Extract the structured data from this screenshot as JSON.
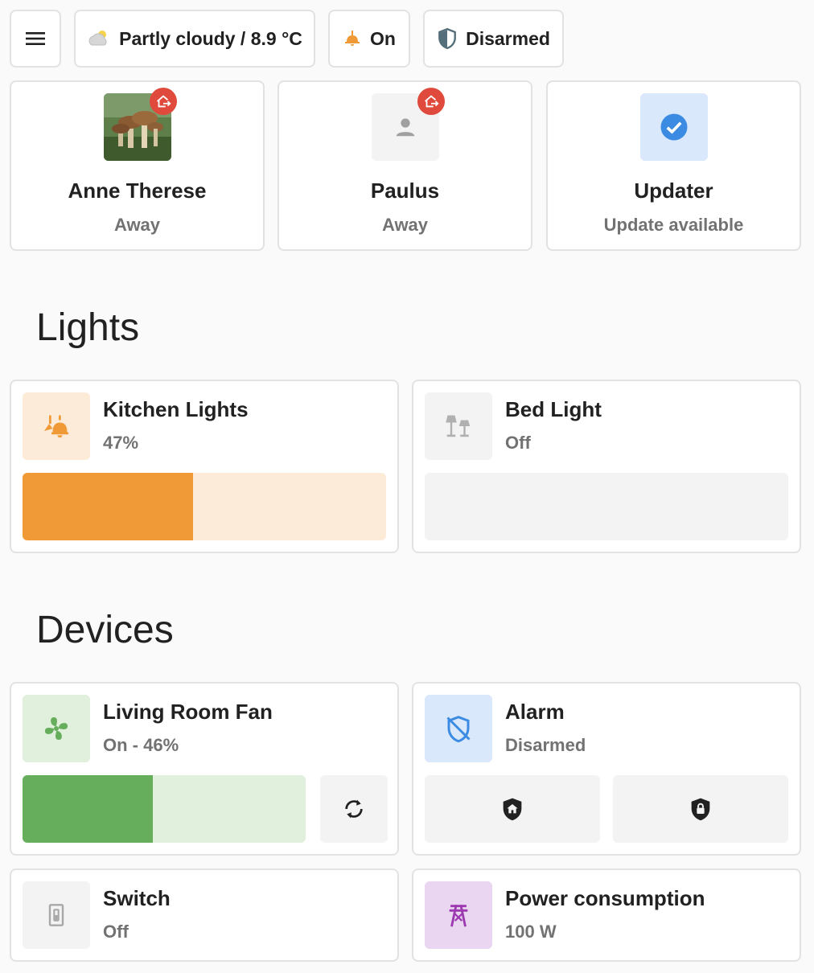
{
  "badges": {
    "menu_icon": "menu-icon",
    "weather": {
      "icon": "partly-cloudy-icon",
      "label": "Partly cloudy / 8.9 °C"
    },
    "light": {
      "icon": "ceiling-light-icon",
      "label": "On"
    },
    "alarm": {
      "icon": "shield-half-icon",
      "label": "Disarmed"
    }
  },
  "tiles": [
    {
      "name": "Anne Therese",
      "state": "Away",
      "icon": "mushroom-photo"
    },
    {
      "name": "Paulus",
      "state": "Away",
      "icon": "account-icon"
    },
    {
      "name": "Updater",
      "state": "Update available",
      "icon": "check-circle-icon"
    }
  ],
  "sections": {
    "lights": "Lights",
    "devices": "Devices"
  },
  "lights": {
    "kitchen": {
      "name": "Kitchen Lights",
      "state": "47%",
      "brightness": 0.47,
      "icon": "ceiling-light-multiple-icon"
    },
    "bed": {
      "name": "Bed Light",
      "state": "Off",
      "brightness": 0,
      "icon": "lamps-icon"
    }
  },
  "devices": {
    "fan": {
      "name": "Living Room Fan",
      "state": "On - 46%",
      "speed": 0.46,
      "icon": "fan-icon",
      "action_icon": "oscillate-icon"
    },
    "alarm": {
      "name": "Alarm",
      "state": "Disarmed",
      "icon": "shield-off-icon",
      "arm_home_icon": "shield-home-icon",
      "arm_away_icon": "shield-lock-icon"
    },
    "switch": {
      "name": "Switch",
      "state": "Off",
      "icon": "light-switch-icon"
    },
    "power": {
      "name": "Power consumption",
      "state": "100 W",
      "icon": "transmission-tower-icon"
    }
  },
  "colors": {
    "light_on": "#f09a37",
    "light_on_bg": "#fcebd8",
    "fan": "#66ad5c",
    "fan_bg": "#e0f0dc",
    "blue": "#3c8be3",
    "blue_bg": "#d9e8fb",
    "purple": "#9c39b0",
    "purple_bg": "#ead6f0",
    "off": "#a0a0a0",
    "off_bg": "#f3f3f3",
    "away": "#e04a3c"
  }
}
